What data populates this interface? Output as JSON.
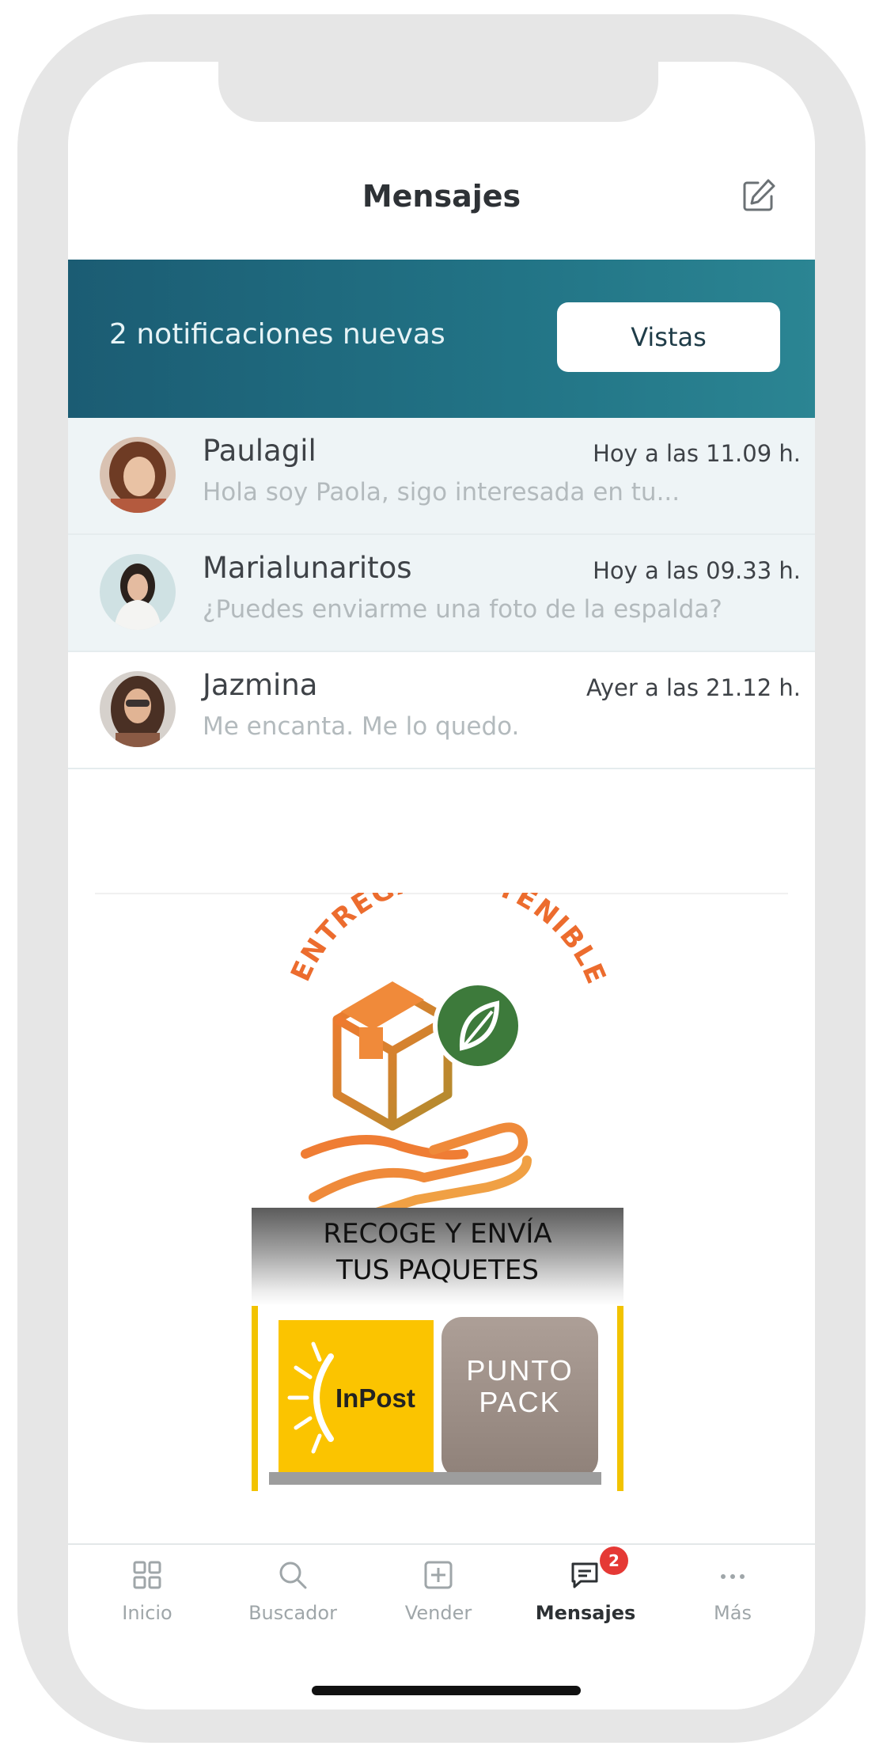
{
  "header": {
    "title": "Mensajes",
    "compose_icon": "compose-icon"
  },
  "notifications": {
    "text": "2 notificaciones nuevas",
    "button_label": "Vistas"
  },
  "messages": [
    {
      "name": "Paulagil",
      "time": "Hoy a las 11.09 h.",
      "preview": "Hola soy Paola, sigo interesada en tu...",
      "unread": true
    },
    {
      "name": "Marialunaritos",
      "time": "Hoy a las 09.33 h.",
      "preview": "¿Puedes enviarme una foto de la espalda?",
      "unread": true
    },
    {
      "name": "Jazmina",
      "time": "Ayer a las 21.12 h.",
      "preview": "Me encanta. Me lo quedo.",
      "unread": false
    }
  ],
  "promo": {
    "logo_text": "ENTREGA SOSTENIBLE",
    "pickup_line1": "RECOGE Y ENVÍA",
    "pickup_line2": "TUS PAQUETES",
    "inpost_label": "InPost",
    "puntopack_line1": "PUNTO",
    "puntopack_line2": "PACK"
  },
  "tabbar": {
    "tabs": [
      {
        "label": "Inicio",
        "icon": "grid-icon"
      },
      {
        "label": "Buscador",
        "icon": "search-icon"
      },
      {
        "label": "Vender",
        "icon": "plus-square-icon"
      },
      {
        "label": "Mensajes",
        "icon": "chat-icon",
        "badge": "2",
        "active": true
      },
      {
        "label": "Más",
        "icon": "more-dots-icon"
      }
    ]
  },
  "colors": {
    "banner": "#1b5c73",
    "accent_orange": "#ef7a32",
    "leaf_green": "#3b7a3a",
    "badge": "#e53935"
  }
}
